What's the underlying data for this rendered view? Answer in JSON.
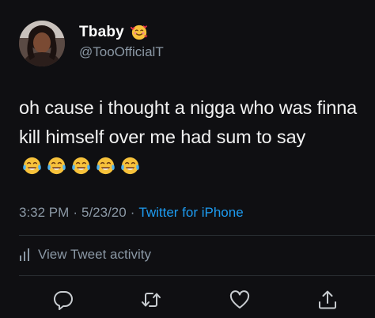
{
  "user": {
    "display_name": "Tbaby",
    "handle": "@TooOfficialT",
    "name_emoji_icon": "smiling-face-with-hearts-icon",
    "avatar_icon": "profile-photo"
  },
  "tweet": {
    "text": "oh cause i thought a nigga who was finna kill himself over me had sum to say",
    "trailing_emoji_icon": "face-with-tears-of-joy-icon",
    "trailing_emoji_count": 5
  },
  "meta": {
    "time": "3:32 PM",
    "date": "5/23/20",
    "separator": "·",
    "source": "Twitter for iPhone"
  },
  "activity": {
    "label": "View Tweet activity",
    "icon": "bar-chart-icon"
  },
  "actions": {
    "reply_icon": "reply-icon",
    "retweet_icon": "retweet-icon",
    "like_icon": "heart-icon",
    "share_icon": "share-icon"
  },
  "colors": {
    "background": "#0f0f12",
    "text_primary": "#f2f2f2",
    "text_secondary": "#8b98a5",
    "accent": "#1d9bf0"
  }
}
